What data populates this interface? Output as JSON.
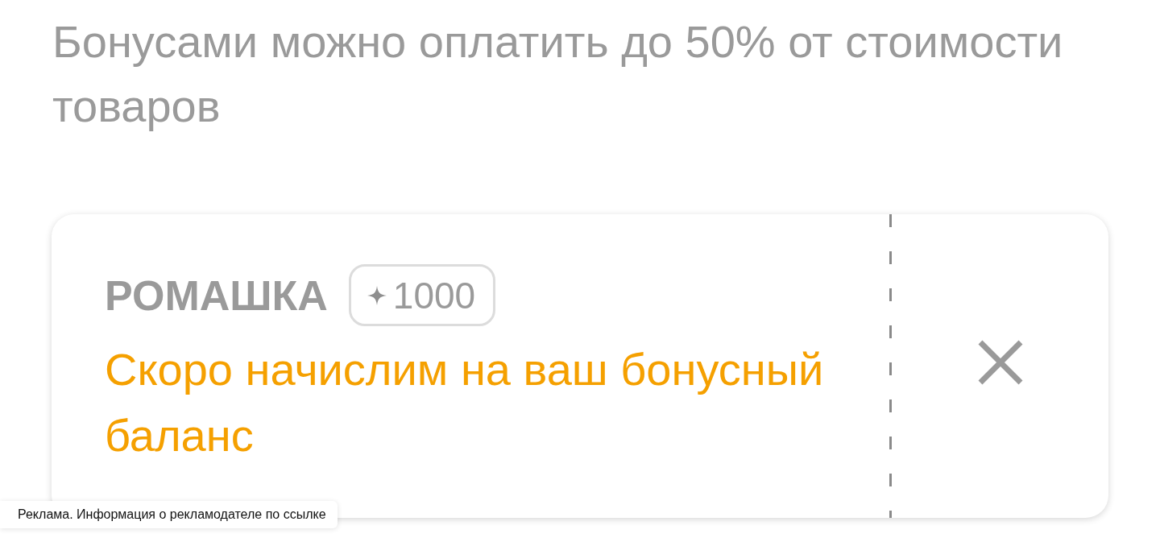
{
  "heading": "Бонусами можно оплатить до 50% от стоимости товаров",
  "card": {
    "brand": "РОМАШКА",
    "bonus_badge": "1000",
    "message": "Скоро начислим на ваш бонусный баланс"
  },
  "ad_label": "Реклама. Информация о рекламодателе по ссылке"
}
